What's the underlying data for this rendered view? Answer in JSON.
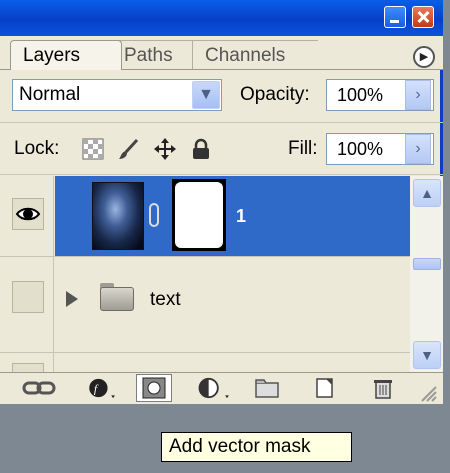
{
  "tabs": [
    {
      "label": "Layers",
      "active": true
    },
    {
      "label": "Paths",
      "active": false
    },
    {
      "label": "Channels",
      "active": false
    }
  ],
  "blend_mode": {
    "value": "Normal"
  },
  "opacity": {
    "label": "Opacity:",
    "value": "100%"
  },
  "lock": {
    "label": "Lock:"
  },
  "fill": {
    "label": "Fill:",
    "value": "100%"
  },
  "layers": [
    {
      "name": "1",
      "visible": true,
      "selected": true
    },
    {
      "name": "text",
      "type": "group",
      "visible": false
    }
  ],
  "tooltip": {
    "text": "Add vector mask"
  },
  "colors": {
    "selection": "#2f6ac9",
    "panel_bg": "#ece9d8",
    "title_blue": "#0a5ee8"
  }
}
